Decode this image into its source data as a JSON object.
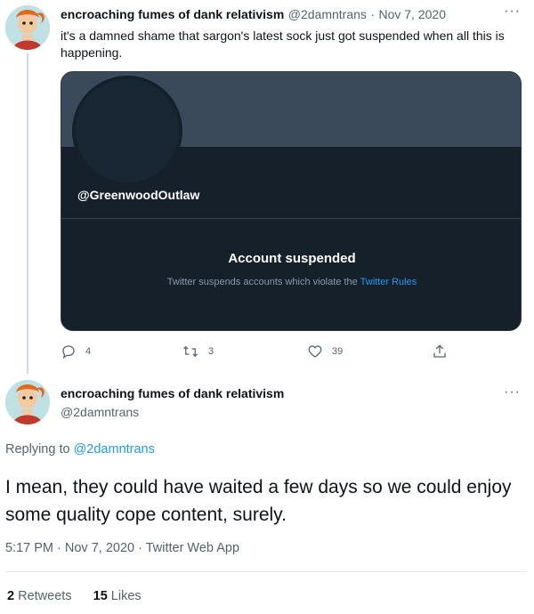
{
  "tweet1": {
    "display_name": "encroaching fumes of dank relativism",
    "handle": "@2damntrans",
    "separator": "·",
    "date": "Nov 7, 2020",
    "text": "it's a damned shame that sargon's latest sock just got suspended when all this is happening.",
    "more_icon": "more-dots-icon",
    "card": {
      "handle": "@GreenwoodOutlaw",
      "title": "Account suspended",
      "subtitle": "Twitter suspends accounts which violate the",
      "link": "Twitter Rules"
    },
    "actions": {
      "replies": "4",
      "retweets": "3",
      "likes": "39"
    }
  },
  "tweet2": {
    "display_name": "encroaching fumes of dank relativism",
    "handle": "@2damntrans",
    "replying_prefix": "Replying to",
    "replying_handle": "@2damntrans",
    "text": "I mean, they could have waited a few days so we could enjoy some quality cope content, surely.",
    "meta": "5:17 PM · Nov 7, 2020 · Twitter Web App",
    "retweets_count": "2",
    "retweets_label": "Retweets",
    "likes_count": "15",
    "likes_label": "Likes"
  },
  "colors": {
    "accent": "#1d9bf0",
    "card_bg": "#15202b",
    "banner": "#3b4a5a"
  }
}
